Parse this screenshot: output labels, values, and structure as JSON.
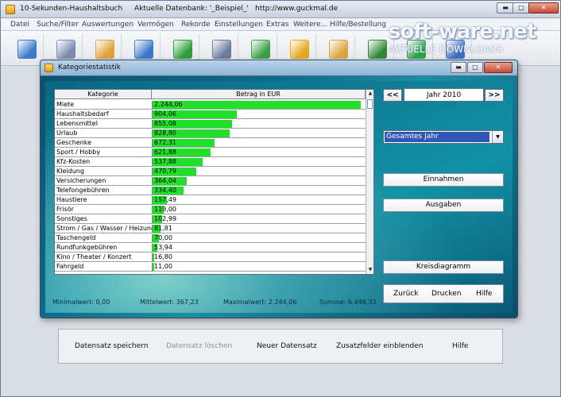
{
  "window": {
    "app_title": "10-Sekunden-Haushaltsbuch",
    "db_text": "Aktuelle Datenbank: '_Beispiel_'",
    "url": "http://www.guckmal.de",
    "min_label": "▬",
    "max_label": "□",
    "close_label": "✕"
  },
  "menu": [
    "Datei",
    "Suche/Filter",
    "Auswertungen",
    "Vermögen",
    "Rekorde",
    "Einstellungen",
    "Extras",
    "Weitere...",
    "Hilfe/Bestellung"
  ],
  "toolbar_icons": [
    {
      "name": "new-document-icon",
      "color": "#3a78c9"
    },
    {
      "name": "database-icon",
      "color": "#7a8db0"
    },
    {
      "name": "tag-icon",
      "color": "#e0a23a"
    },
    {
      "name": "bar-chart-icon",
      "color": "#3c78c8"
    },
    {
      "name": "pie-chart-icon",
      "color": "#2e9e3c"
    },
    {
      "name": "line-chart-icon",
      "color": "#6c7aa0"
    },
    {
      "name": "speech-bubble-icon",
      "color": "#3aa048"
    },
    {
      "name": "coins-icon",
      "color": "#e5a81d"
    },
    {
      "name": "notes-icon",
      "color": "#d9a640"
    },
    {
      "name": "book-icon",
      "color": "#2e8a35"
    },
    {
      "name": "arrows-icon",
      "color": "#2fa04a"
    },
    {
      "name": "globe-icon",
      "color": "#3b6fc4"
    }
  ],
  "watermark": {
    "big": "soft-ware.net",
    "small": "AKTUELLE DOWNLOADS"
  },
  "dialog": {
    "title": "Kategoriestatistik",
    "column_category": "Kategorie",
    "column_amount": "Betrag in EUR",
    "scroll_up": "▲",
    "scroll_down": "▼",
    "rows": [
      {
        "category": "Miete",
        "value": "2.244,06",
        "amount": 2244.06
      },
      {
        "category": "Haushaltsbedarf",
        "value": "904,06",
        "amount": 904.06
      },
      {
        "category": "Lebensmittel",
        "value": "855,08",
        "amount": 855.08
      },
      {
        "category": "Urlaub",
        "value": "828,80",
        "amount": 828.8
      },
      {
        "category": "Geschenke",
        "value": "672,31",
        "amount": 672.31
      },
      {
        "category": "Sport / Hobby",
        "value": "621,88",
        "amount": 621.88
      },
      {
        "category": "Kfz-Kosten",
        "value": "537,88",
        "amount": 537.88
      },
      {
        "category": "Kleidung",
        "value": "470,79",
        "amount": 470.79
      },
      {
        "category": "Versicherungen",
        "value": "364,04",
        "amount": 364.04
      },
      {
        "category": "Telefongebühren",
        "value": "334,40",
        "amount": 334.4
      },
      {
        "category": "Haustiere",
        "value": "157,49",
        "amount": 157.49
      },
      {
        "category": "Frisör",
        "value": "119,00",
        "amount": 119.0
      },
      {
        "category": "Sonstiges",
        "value": "102,99",
        "amount": 102.99
      },
      {
        "category": "Strom / Gas / Wasser / Heizung",
        "value": "81,81",
        "amount": 81.81
      },
      {
        "category": "Taschengeld",
        "value": "70,00",
        "amount": 70.0
      },
      {
        "category": "Rundfunkgebühren",
        "value": "53,94",
        "amount": 53.94
      },
      {
        "category": "Kino / Theater / Konzert",
        "value": "16,80",
        "amount": 16.8
      },
      {
        "category": "Fahrgeld",
        "value": "11,00",
        "amount": 11.0
      }
    ],
    "stats": {
      "min": "Minimalwert:  0,00",
      "mean": "Mittelwert:  367,23",
      "max": "Maximalwert:  2.244,06",
      "sum": "Summe:  6.446,33"
    },
    "prev_label": "<<",
    "next_label": ">>",
    "year": "Jahr 2010",
    "period_selected": "Gesamtes Jahr",
    "select_arrow": "▼",
    "income_button": "Einnahmen",
    "expenses_button": "Ausgaben",
    "pie_button": "Kreisdiagramm",
    "back_button": "Zurück",
    "print_button": "Drucken",
    "help_button": "Hilfe"
  },
  "bottom": {
    "save": "Datensatz speichern",
    "delete": "Datensatz löschen",
    "new": "Neuer Datensatz",
    "extra": "Zusatzfelder einblenden",
    "help": "Hilfe"
  }
}
